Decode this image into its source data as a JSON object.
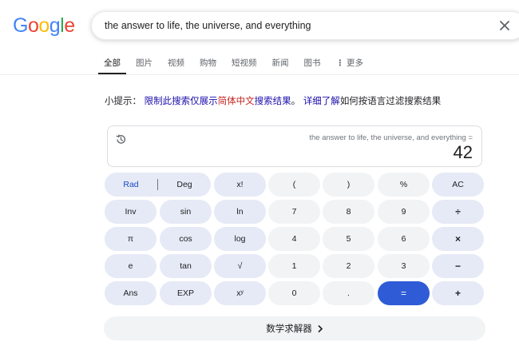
{
  "logo": {
    "letters": [
      "G",
      "o",
      "o",
      "g",
      "l",
      "e"
    ],
    "colors": [
      "#4285f4",
      "#ea4335",
      "#fbbc05",
      "#4285f4",
      "#34a853",
      "#ea4335"
    ]
  },
  "search": {
    "query": "the answer to life, the universe, and everything",
    "clear_icon": "close-icon"
  },
  "tabs": [
    "全部",
    "图片",
    "视频",
    "购物",
    "短视频",
    "新闻",
    "图书",
    "更多"
  ],
  "hint": {
    "prefix": "小提示：",
    "link1a": "限制此搜索仅展示",
    "link1b": "简体中文",
    "link1c": "搜索结果",
    "period": "。",
    "link2": "详细了解",
    "suffix": "如何按语言过滤搜索结果"
  },
  "calculator": {
    "expression": "the answer to life, the universe, and everything =",
    "result": "42",
    "history_icon": "history-icon",
    "keys": {
      "rad": "Rad",
      "deg": "Deg",
      "fact": "x!",
      "lparen": "(",
      "rparen": ")",
      "percent": "%",
      "ac": "AC",
      "inv": "Inv",
      "sin": "sin",
      "ln": "ln",
      "seven": "7",
      "eight": "8",
      "nine": "9",
      "divide": "÷",
      "pi": "π",
      "cos": "cos",
      "log": "log",
      "four": "4",
      "five": "5",
      "six": "6",
      "multiply": "×",
      "e": "e",
      "tan": "tan",
      "sqrt": "√",
      "one": "1",
      "two": "2",
      "three": "3",
      "minus": "−",
      "ans": "Ans",
      "exp": "EXP",
      "pow": "xʸ",
      "zero": "0",
      "dot": ".",
      "equals": "=",
      "plus": "+"
    }
  },
  "solver": {
    "label": "数学求解器"
  },
  "colors": {
    "accent_blue": "#2f5bd6",
    "link": "#1a0dab",
    "highlight_red": "#c5221f"
  }
}
